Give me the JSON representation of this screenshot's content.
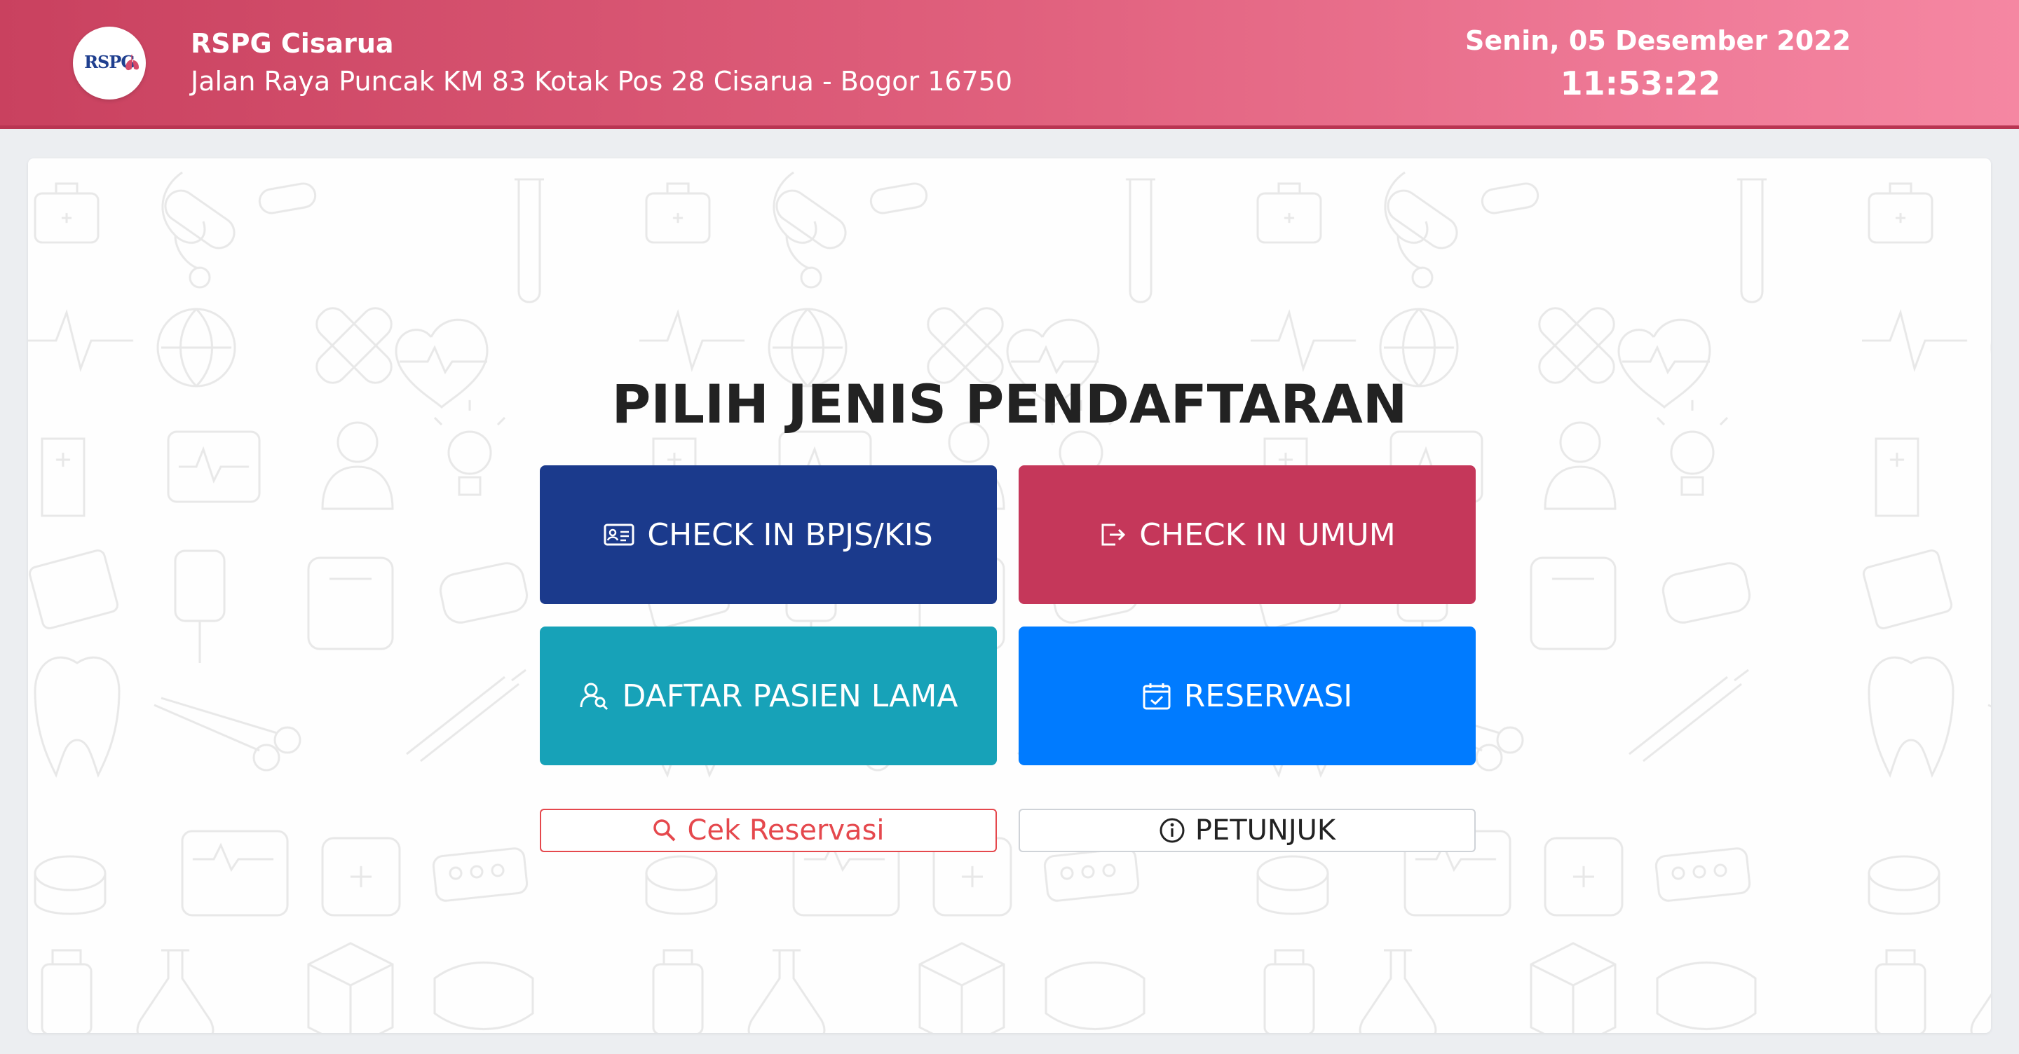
{
  "header": {
    "logo_text": "RSPG",
    "hospital_name": "RSPG Cisarua",
    "address": "Jalan Raya Puncak KM 83 Kotak Pos 28 Cisarua - Bogor 16750",
    "date": "Senin, 05 Desember 2022",
    "time": "11:53:22"
  },
  "main": {
    "title": "PILIH JENIS PENDAFTARAN",
    "buttons": {
      "checkin_bpjs": "CHECK IN BPJS/KIS",
      "checkin_umum": "CHECK IN UMUM",
      "daftar_pasien_lama": "DAFTAR PASIEN LAMA",
      "reservasi": "RESERVASI",
      "cek_reservasi": "Cek Reservasi",
      "petunjuk": "PETUNJUK"
    }
  },
  "colors": {
    "header_start": "#c9415f",
    "header_end": "#f587a2",
    "bpjs": "#1b3a8c",
    "umum": "#c5375a",
    "pasien_lama": "#17a2b8",
    "reservasi": "#007bff",
    "cek_reservasi": "#e5484d"
  },
  "icons": {
    "checkin_bpjs": "id-card-icon",
    "checkin_umum": "box-arrow-right-icon",
    "daftar_pasien_lama": "person-search-icon",
    "reservasi": "calendar-check-icon",
    "cek_reservasi": "search-icon",
    "petunjuk": "info-circle-icon"
  }
}
